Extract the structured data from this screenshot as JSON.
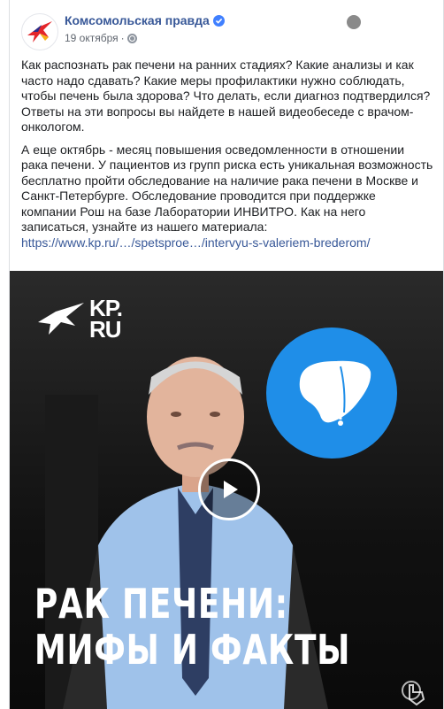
{
  "post": {
    "page_name": "Комсомольская правда",
    "date": "19 октября",
    "paragraph1": "Как распознать рак печени на ранних стадиях? Какие анализы и как часто надо сдавать? Какие меры профилактики нужно соблюдать, чтобы печень была здорова? Что делать, если диагноз подтвердился? Ответы на эти вопросы вы найдете в нашей видеобеседе с врачом-онкологом.",
    "paragraph2": "А еще октябрь - месяц повышения осведомленности в отношении рака печени. У пациентов из групп риска есть уникальная возможность бесплатно пройти обследование на наличие рака печени в Москве и Санкт-Петербурге. Обследование проводится при поддержке компании Рош на базе Лаборатории ИНВИТРО. Как на него записаться, узнайте из нашего материала:",
    "link": "https://www.kp.ru/…/spetsproe…/intervyu-s-valeriem-brederom/"
  },
  "video": {
    "logo_line1": "KP.",
    "logo_line2": "RU",
    "headline_line1": "РАК ПЕЧЕНИ:",
    "headline_line2": "МИФЫ И ФАКТЫ"
  },
  "colors": {
    "link": "#385898",
    "liver_circle": "#1f8ee8",
    "verified": "#4080ff"
  }
}
